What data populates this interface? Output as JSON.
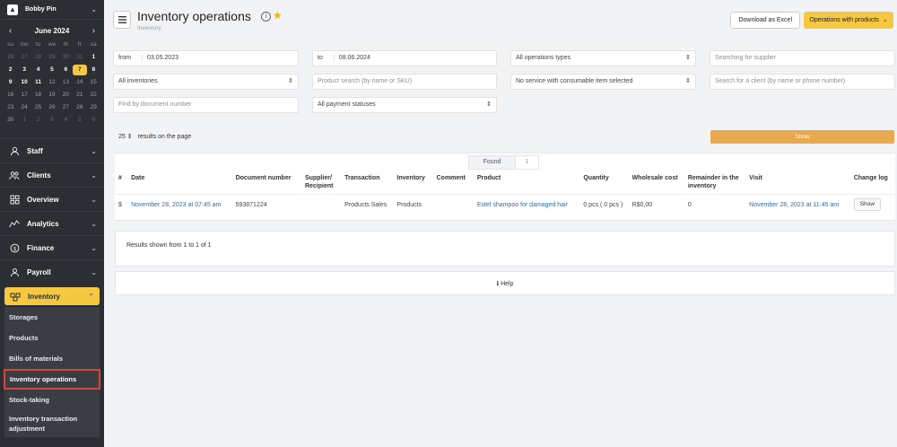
{
  "sidebar": {
    "user_name": "Bobby Pin",
    "calendar": {
      "month": "June 2024",
      "weekdays": [
        "su",
        "mo",
        "tu",
        "we",
        "th",
        "fr",
        "sa"
      ],
      "weeks": [
        [
          "26",
          "27",
          "28",
          "29",
          "30",
          "31",
          "1"
        ],
        [
          "2",
          "3",
          "4",
          "5",
          "6",
          "7",
          "8"
        ],
        [
          "9",
          "10",
          "11",
          "12",
          "13",
          "14",
          "15"
        ],
        [
          "16",
          "17",
          "18",
          "19",
          "20",
          "21",
          "22"
        ],
        [
          "23",
          "24",
          "25",
          "26",
          "27",
          "28",
          "29"
        ],
        [
          "30",
          "1",
          "2",
          "3",
          "4",
          "5",
          "6"
        ]
      ],
      "today": "7"
    },
    "nav": [
      {
        "label": "Staff",
        "icon": "staff-icon"
      },
      {
        "label": "Clients",
        "icon": "clients-icon"
      },
      {
        "label": "Overview",
        "icon": "overview-icon"
      },
      {
        "label": "Analytics",
        "icon": "analytics-icon"
      },
      {
        "label": "Finance",
        "icon": "finance-icon"
      },
      {
        "label": "Payroll",
        "icon": "payroll-icon"
      }
    ],
    "inventory": {
      "label": "Inventory",
      "icon": "inventory-icon"
    },
    "inventory_sub": [
      {
        "label": "Storages"
      },
      {
        "label": "Products"
      },
      {
        "label": "Bills of materials"
      },
      {
        "label": "Inventory operations"
      },
      {
        "label": "Stock-taking"
      },
      {
        "label": "Inventory transaction adjustment"
      }
    ]
  },
  "header": {
    "title": "Inventory operations",
    "breadcrumb": "Inventory",
    "download_label": "Download as Excel",
    "operations_label": "Operations with products"
  },
  "filters": {
    "from_label": "from",
    "from_value": "03.05.2023",
    "to_label": "to",
    "to_value": "08.06.2024",
    "operation_types": "All operations types",
    "supplier_placeholder": "Searching for supplier",
    "inventories": "All inventories",
    "product_placeholder": "Product search (by name or SKU)",
    "service_consumable": "No service with consumable item selected",
    "client_placeholder": "Search for a client (by name or phone number)",
    "document_placeholder": "Find by document number",
    "payment_statuses": "All payment statuses",
    "per_page_value": "25",
    "per_page_label": "results on the page",
    "show_label": "Show"
  },
  "found": {
    "label": "Found",
    "count": "1"
  },
  "table": {
    "headers": [
      "#",
      "Date",
      "Document number",
      "Supplier/ Recipient",
      "Transaction",
      "Inventory",
      "Comment",
      "Product",
      "Quantity",
      "Wholesale cost",
      "Remainder in the inventory",
      "Visit",
      "Change log"
    ],
    "rows": [
      {
        "icon": "$",
        "date": "November 28, 2023 at 07:45 am",
        "document": "593871224",
        "supplier": "",
        "transaction": "Products Sales",
        "inventory": "Products",
        "comment": "",
        "product": "Estel shampoo for damaged hair",
        "quantity": "0 pcs ( 0 pcs )",
        "wholesale": "R$0,00",
        "remainder": "0",
        "visit": "November 28, 2023 at 11:45 am",
        "changelog": "Show"
      }
    ]
  },
  "results_text": "Results shown from 1 to 1 of 1",
  "help_label": "Help",
  "colors": {
    "accent": "#f5c842",
    "show_button": "#e9a94e",
    "link": "#2e6db4",
    "sidebar_bg": "#2b2e33",
    "active_outline": "#d64535"
  }
}
